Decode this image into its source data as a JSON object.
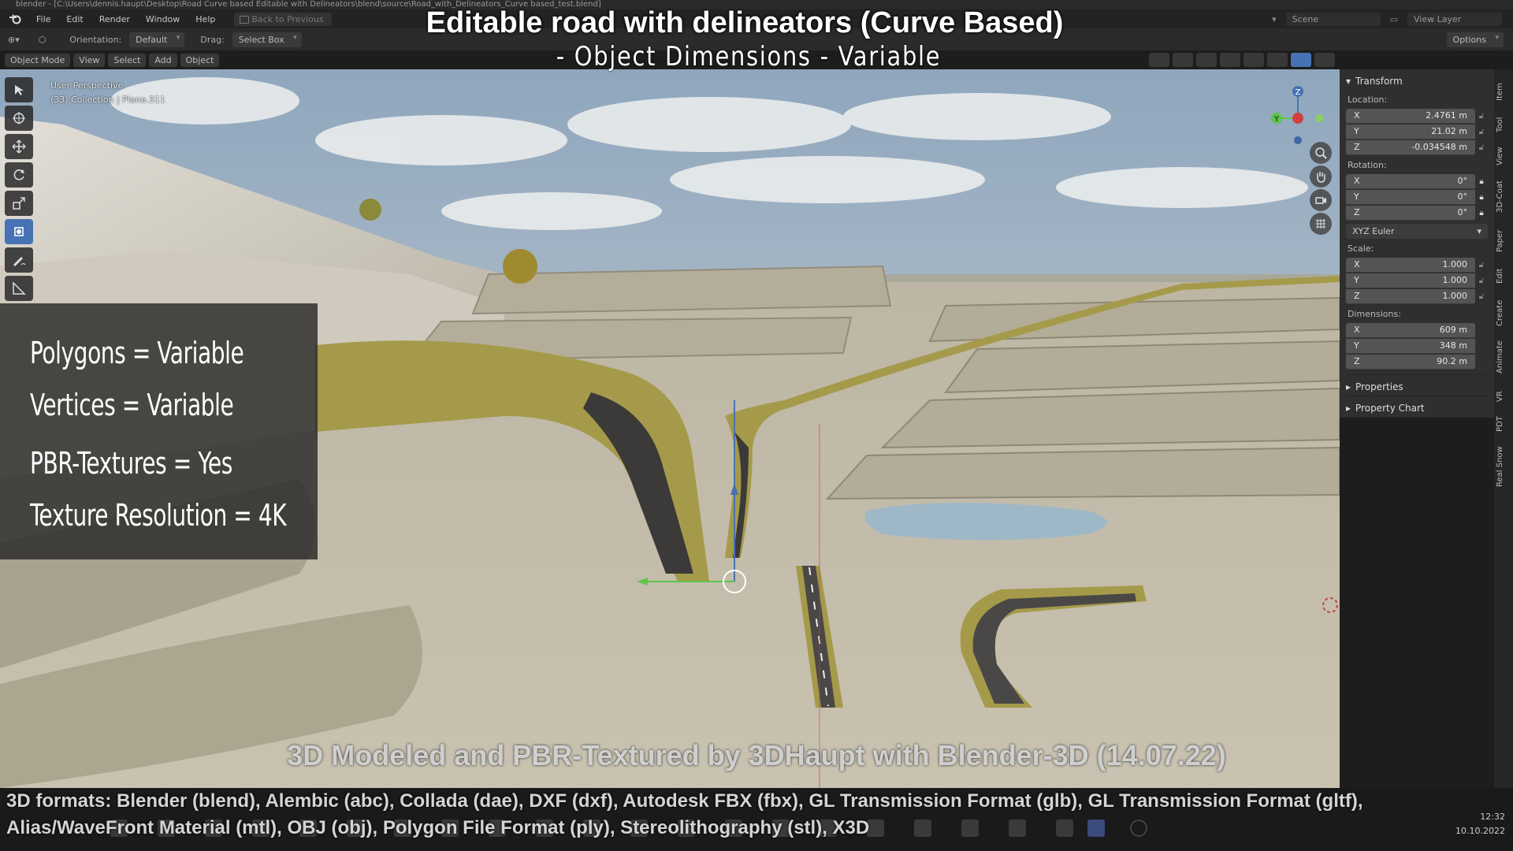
{
  "window_title": "blender - [C:\\Users\\dennis.haupt\\Desktop\\Road Curve based Editable with Delineators\\blend\\source\\Road_with_Delineators_Curve based_test.blend]",
  "menu": {
    "file": "File",
    "edit": "Edit",
    "render": "Render",
    "window": "Window",
    "help": "Help",
    "back": "Back to Previous",
    "scene": "Scene",
    "view_layer": "View Layer"
  },
  "toolbar": {
    "orientation_label": "Orientation:",
    "orientation_value": "Default",
    "drag_label": "Drag:",
    "drag_value": "Select Box",
    "options": "Options"
  },
  "viewport_header": {
    "mode": "Object Mode",
    "view": "View",
    "select": "Select",
    "add": "Add",
    "object": "Object"
  },
  "overlay": {
    "title": "Editable road with delineators (Curve Based)",
    "subtitle": "- Object Dimensions -  Variable",
    "stats": [
      "Polygons = Variable",
      "Vertices = Variable",
      "PBR-Textures =  Yes",
      "Texture Resolution = 4K"
    ],
    "credit": "3D Modeled and PBR-Textured by 3DHaupt with Blender-3D (14.07.22)",
    "formats": "3D formats: Blender (blend), Alembic (abc), Collada (dae), DXF (dxf), Autodesk FBX (fbx), GL Transmission Format (glb), GL Transmission Format (gltf), Alias/WaveFront Material (mtl), OBJ (obj), Polygon File Format (ply), Stereolithography (stl), X3D"
  },
  "viewport": {
    "perspective": "User Perspective",
    "collection": "(33) Collection | Plane.311"
  },
  "gizmo": {
    "x": "X",
    "y": "Y",
    "z": "Z"
  },
  "npanel": {
    "transform": "Transform",
    "location_label": "Location:",
    "location": [
      {
        "axis": "X",
        "value": "2.4761 m"
      },
      {
        "axis": "Y",
        "value": "21.02 m"
      },
      {
        "axis": "Z",
        "value": "-0.034548 m"
      }
    ],
    "rotation_label": "Rotation:",
    "rotation": [
      {
        "axis": "X",
        "value": "0°"
      },
      {
        "axis": "Y",
        "value": "0°"
      },
      {
        "axis": "Z",
        "value": "0°"
      }
    ],
    "rotation_mode": "XYZ Euler",
    "scale_label": "Scale:",
    "scale": [
      {
        "axis": "X",
        "value": "1.000"
      },
      {
        "axis": "Y",
        "value": "1.000"
      },
      {
        "axis": "Z",
        "value": "1.000"
      }
    ],
    "dimensions_label": "Dimensions:",
    "dimensions": [
      {
        "axis": "X",
        "value": "609 m"
      },
      {
        "axis": "Y",
        "value": "348 m"
      },
      {
        "axis": "Z",
        "value": "90.2 m"
      }
    ],
    "properties": "Properties",
    "property_chart": "Property Chart"
  },
  "side_tabs": [
    "Item",
    "Tool",
    "View",
    "3D-Coat",
    "Paper",
    "Edit",
    "Create",
    "Animate",
    "VR",
    "PDT",
    "Real Snow"
  ],
  "clock": {
    "time": "12:32",
    "date": "10.10.2022"
  },
  "colors": {
    "accent": "#4772b3",
    "road": "#3c3a38",
    "shoulder": "#a49a4a",
    "sky": "#9fb3c6"
  }
}
